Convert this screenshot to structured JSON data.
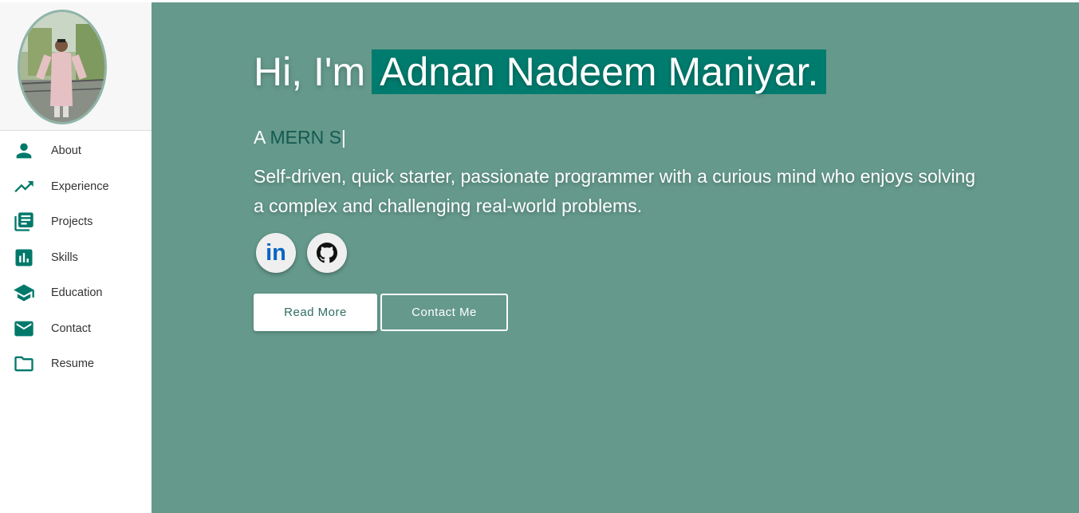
{
  "profile": {
    "photo_alt": "profile-photo"
  },
  "sidebar": {
    "items": [
      {
        "label": "About",
        "icon": "person-icon"
      },
      {
        "label": "Experience",
        "icon": "trending-up-icon"
      },
      {
        "label": "Projects",
        "icon": "library-books-icon"
      },
      {
        "label": "Skills",
        "icon": "bar-chart-icon"
      },
      {
        "label": "Education",
        "icon": "school-icon"
      },
      {
        "label": "Contact",
        "icon": "mail-icon"
      },
      {
        "label": "Resume",
        "icon": "folder-icon"
      }
    ]
  },
  "hero": {
    "greeting_prefix": "Hi, I'm",
    "name": "Adnan Nadeem Maniyar.",
    "typed_prefix": "A ",
    "typed_text": "MERN S",
    "typed_cursor": "|",
    "bio": "Self-driven, quick starter, passionate programmer with a curious mind who enjoys solving a complex and challenging real-world problems.",
    "social": [
      {
        "name": "linkedin",
        "glyph": "in",
        "icon": "linkedin-icon"
      },
      {
        "name": "github",
        "icon": "github-icon"
      }
    ],
    "buttons": {
      "read_more": "Read More",
      "contact_me": "Contact Me"
    }
  },
  "colors": {
    "accent": "#00796b",
    "hero_bg": "#64998b",
    "name_highlight": "#007c6e",
    "typed_text": "#145a50",
    "linkedin": "#0a66c2"
  }
}
